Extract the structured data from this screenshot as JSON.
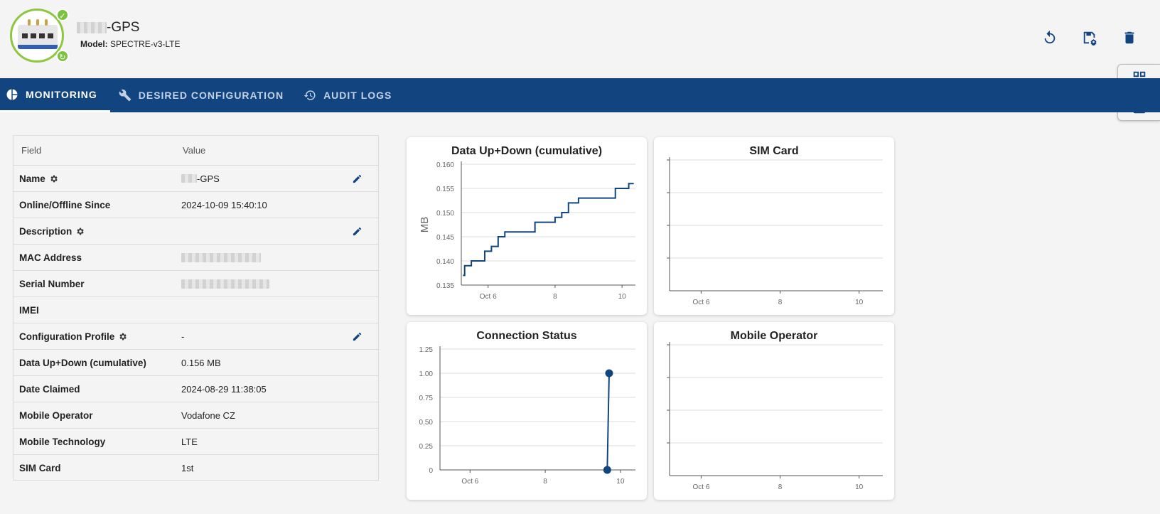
{
  "header": {
    "device_name_suffix": "-GPS",
    "model_label": "Model:",
    "model_value": "SPECTRE-v3-LTE"
  },
  "tabs": [
    {
      "label": "MONITORING",
      "icon": "pie-chart-icon"
    },
    {
      "label": "DESIRED CONFIGURATION",
      "icon": "wrench-icon"
    },
    {
      "label": "AUDIT LOGS",
      "icon": "history-icon"
    }
  ],
  "table": {
    "header": {
      "field": "Field",
      "value": "Value"
    },
    "rows": [
      {
        "field": "Name",
        "value": "-GPS"
      },
      {
        "field": "Online/Offline Since",
        "value": "2024-10-09 15:40:10"
      },
      {
        "field": "Description",
        "value": ""
      },
      {
        "field": "MAC Address",
        "value": ""
      },
      {
        "field": "Serial Number",
        "value": ""
      },
      {
        "field": "IMEI",
        "value": ""
      },
      {
        "field": "Configuration Profile",
        "value": "-"
      },
      {
        "field": "Data Up+Down (cumulative)",
        "value": "0.156 MB"
      },
      {
        "field": "Date Claimed",
        "value": "2024-08-29 11:38:05"
      },
      {
        "field": "Mobile Operator",
        "value": "Vodafone CZ"
      },
      {
        "field": "Mobile Technology",
        "value": "LTE"
      },
      {
        "field": "SIM Card",
        "value": "1st"
      }
    ]
  },
  "colors": {
    "primary": "#12457f",
    "badge": "#7cc242"
  },
  "chart_data": [
    {
      "type": "line",
      "title": "Data Up+Down (cumulative)",
      "ylabel": "MB",
      "xlabel": "",
      "ylim": [
        0.135,
        0.16
      ],
      "xlim": [
        5.2,
        10.4
      ],
      "yticks": [
        "0.160",
        "0.155",
        "0.150",
        "0.145",
        "0.140",
        "0.135"
      ],
      "ytick_values": [
        0.16,
        0.155,
        0.15,
        0.145,
        0.14,
        0.135
      ],
      "xticks": [
        "Oct 6",
        "8",
        "10"
      ],
      "xtick_values": [
        6,
        8,
        10
      ],
      "step": true,
      "x": [
        5.25,
        5.3,
        5.5,
        5.7,
        5.9,
        6.1,
        6.3,
        6.5,
        7.2,
        7.4,
        7.6,
        8.0,
        8.2,
        8.4,
        8.7,
        9.0,
        9.4,
        9.8,
        10.2,
        10.35
      ],
      "y": [
        0.137,
        0.139,
        0.14,
        0.14,
        0.142,
        0.143,
        0.145,
        0.146,
        0.146,
        0.148,
        0.148,
        0.149,
        0.15,
        0.152,
        0.153,
        0.153,
        0.153,
        0.155,
        0.156,
        0.156
      ],
      "grid": true
    },
    {
      "type": "line",
      "title": "SIM Card",
      "xticks": [
        "Oct 6",
        "8",
        "10"
      ],
      "xtick_values": [
        6,
        8,
        10
      ],
      "xlim": [
        5.2,
        10.6
      ],
      "series": [],
      "grid": true,
      "ygrid_lines": 4
    },
    {
      "type": "line",
      "title": "Connection Status",
      "ylim": [
        0,
        1.25
      ],
      "xlim": [
        5.2,
        10.4
      ],
      "yticks": [
        "1.25",
        "1.00",
        "0.75",
        "0.50",
        "0.25",
        "0"
      ],
      "ytick_values": [
        1.25,
        1.0,
        0.75,
        0.5,
        0.25,
        0
      ],
      "xticks": [
        "Oct 6",
        "8",
        "10"
      ],
      "xtick_values": [
        6,
        8,
        10
      ],
      "x": [
        9.65,
        9.7
      ],
      "y": [
        0,
        1
      ],
      "markers": true,
      "grid": true
    },
    {
      "type": "line",
      "title": "Mobile Operator",
      "xticks": [
        "Oct 6",
        "8",
        "10"
      ],
      "xtick_values": [
        6,
        8,
        10
      ],
      "xlim": [
        5.2,
        10.6
      ],
      "series": [],
      "grid": true,
      "ygrid_lines": 4
    }
  ]
}
